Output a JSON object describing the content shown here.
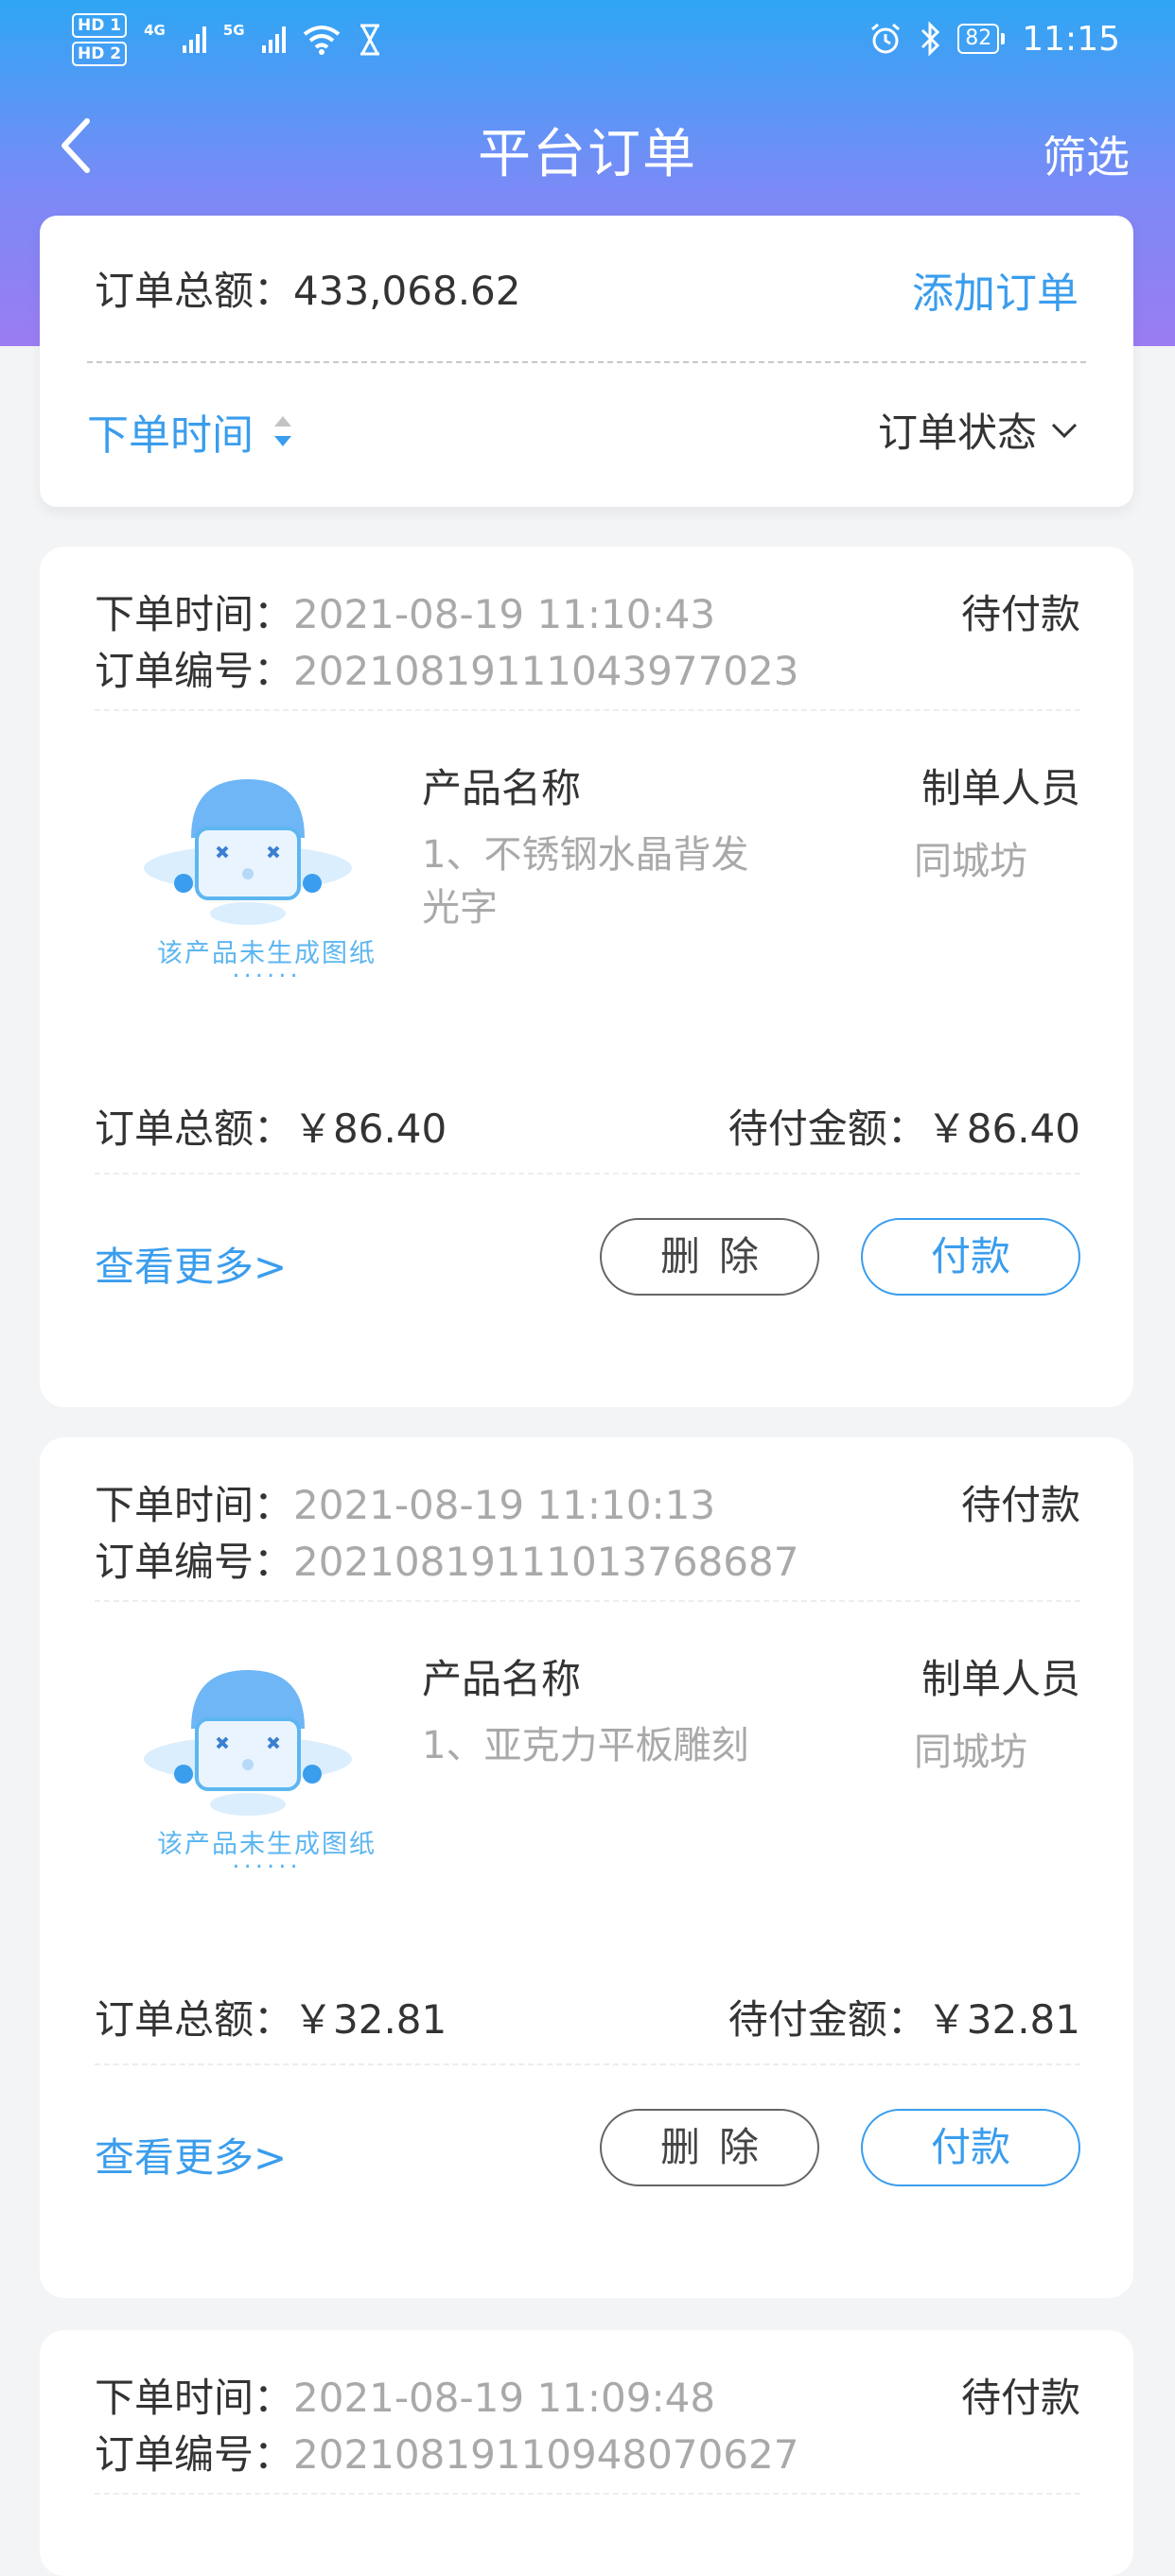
{
  "status_bar": {
    "hd1": "HD 1",
    "hd2": "HD 2",
    "net1": "4G",
    "net2": "5G",
    "battery": "82",
    "time": "11:15"
  },
  "nav": {
    "title": "平台订单",
    "filter": "筛选"
  },
  "summary": {
    "total_label": "订单总额：",
    "total_value": "433,068.62",
    "add_order": "添加订单",
    "sort_label": "下单时间",
    "status_filter": "订单状态"
  },
  "orders": [
    {
      "time_label": "下单时间：",
      "time": "2021-08-19 11:10:43",
      "no_label": "订单编号：",
      "no": "20210819111043977023",
      "status": "待付款",
      "placeholder": "该产品未生成图纸",
      "placeholder_dots": "......",
      "product_header": "产品名称",
      "product": "1、不锈钢水晶背发光字",
      "maker_header": "制单人员",
      "maker": "同城坊",
      "total": "订单总额：￥86.40",
      "pending": "待付金额：￥86.40",
      "more": "查看更多>",
      "delete": "删除",
      "pay": "付款"
    },
    {
      "time_label": "下单时间：",
      "time": "2021-08-19 11:10:13",
      "no_label": "订单编号：",
      "no": "20210819111013768687",
      "status": "待付款",
      "placeholder": "该产品未生成图纸",
      "placeholder_dots": "......",
      "product_header": "产品名称",
      "product": "1、亚克力平板雕刻",
      "maker_header": "制单人员",
      "maker": "同城坊",
      "total": "订单总额：￥32.81",
      "pending": "待付金额：￥32.81",
      "more": "查看更多>",
      "delete": "删除",
      "pay": "付款"
    },
    {
      "time_label": "下单时间：",
      "time": "2021-08-19 11:09:48",
      "no_label": "订单编号：",
      "no": "20210819110948070627",
      "status": "待付款"
    }
  ],
  "colors": {
    "accent": "#3a9ded",
    "header_top": "#2fa6f4",
    "header_bottom": "#9b7cf2"
  }
}
